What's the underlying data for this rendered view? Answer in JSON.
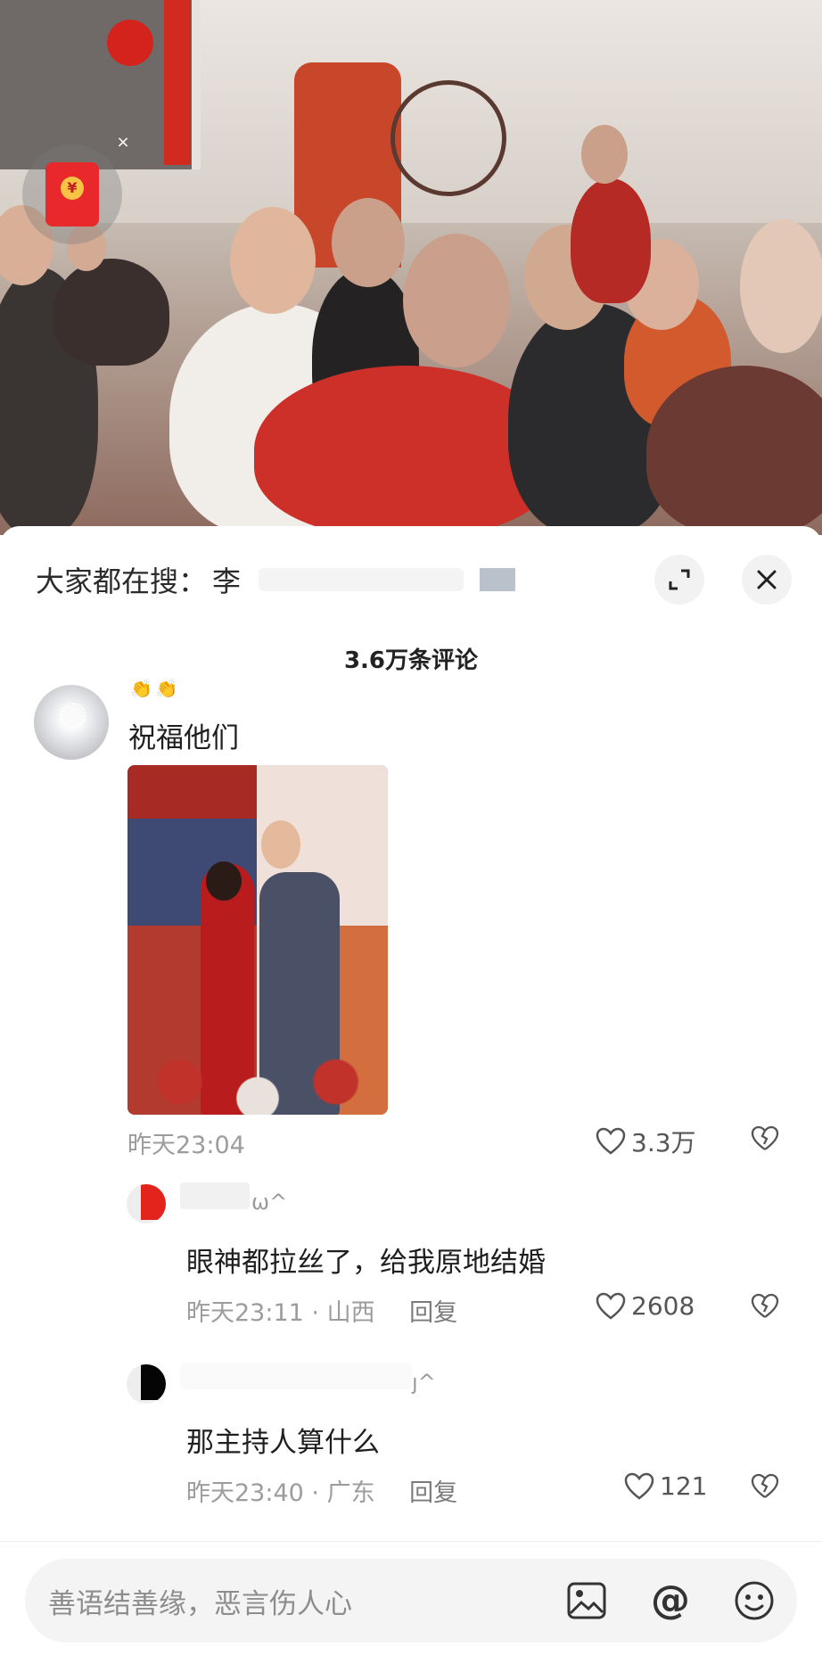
{
  "search": {
    "label": "大家都在搜：",
    "term": "李"
  },
  "comments": {
    "count_title": "3.6万条评论",
    "items": [
      {
        "emoji": "👏👏",
        "text": "祝福他们",
        "time": "昨天23:04",
        "likes": "3.3万"
      },
      {
        "name_tail": "ω^",
        "text": "眼神都拉丝了，给我原地结婚",
        "time": "昨天23:11",
        "location": "山西",
        "reply_label": "回复",
        "likes": "2608"
      },
      {
        "name_tail": "ȷ^",
        "text": "那主持人算什么",
        "time": "昨天23:40",
        "location": "广东",
        "reply_label": "回复",
        "likes": "121"
      }
    ]
  },
  "input": {
    "placeholder": "善语结善缘，恶言伤人心"
  },
  "icons": {
    "red_packet": "red-packet-icon",
    "red_packet_coin": "¥",
    "close_small": "×"
  },
  "colors": {
    "accent_red": "#e8282b",
    "text_gray": "#9c9c9c"
  }
}
